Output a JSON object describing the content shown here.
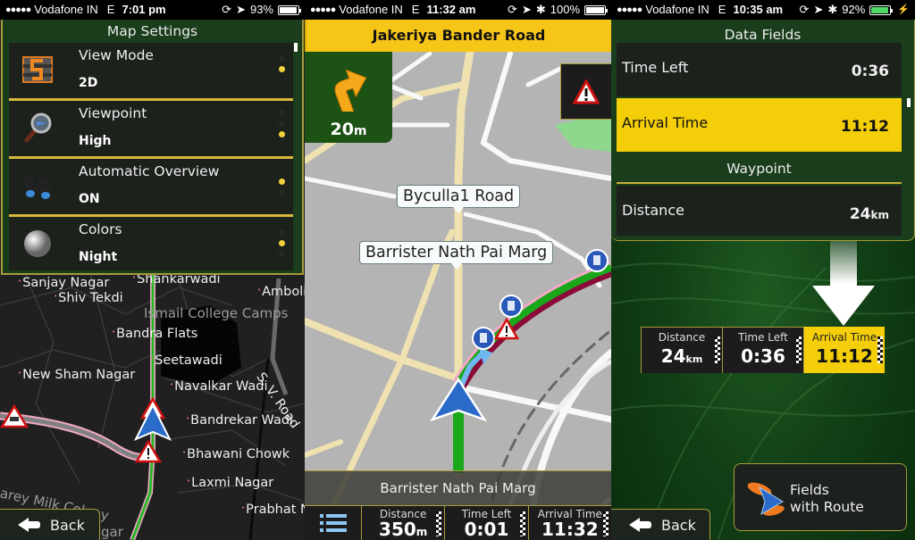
{
  "screens": [
    {
      "status": {
        "carrier": "Vodafone IN",
        "network": "E",
        "time": "7:01 pm",
        "battery": "93%"
      },
      "settings": {
        "title": "Map Settings",
        "items": [
          {
            "label": "View Mode",
            "value": "2D",
            "icon": "view-mode-icon",
            "options_count": 2,
            "selected_index": 1
          },
          {
            "label": "Viewpoint",
            "value": "High",
            "icon": "magnifier-icon",
            "options_count": 3,
            "selected_index": 2
          },
          {
            "label": "Automatic Overview",
            "value": "ON",
            "icon": "binoculars-icon",
            "options_count": 2,
            "selected_index": 0
          },
          {
            "label": "Colors",
            "value": "Night",
            "icon": "moon-icon",
            "options_count": 3,
            "selected_index": 1
          }
        ]
      },
      "map_places": [
        "Sanjay Nagar",
        "Shankarwadi",
        "Amboli",
        "Shiv Tekdi",
        "Ismail College Camps",
        "Bandra Flats",
        "Seetawadi",
        "New Sham Nagar",
        "Navalkar Wadi",
        "S. V. Road",
        "Bandrekar Wadi",
        "Bhawani Chowk",
        "arey Milk Colony",
        "Laxmi Nagar",
        "Prabhat N",
        "gar"
      ],
      "back_label": "Back"
    },
    {
      "status": {
        "carrier": "Vodafone IN",
        "network": "E",
        "time": "11:32 am",
        "battery": "100%"
      },
      "current_street": "Jakeriya Bander Road",
      "next_turn": {
        "distance": "20",
        "unit": "m",
        "direction": "slight-right"
      },
      "callouts": [
        "Byculla1 Road",
        "Barrister Nath Pai Marg"
      ],
      "next_street": "Barrister Nath Pai Marg",
      "data_fields": [
        {
          "label": "Distance",
          "value": "350",
          "unit": "m"
        },
        {
          "label": "Time Left",
          "value": "0:01",
          "unit": ""
        },
        {
          "label": "Arrival Time",
          "value": "11:32",
          "unit": ""
        }
      ]
    },
    {
      "status": {
        "carrier": "Vodafone IN",
        "network": "E",
        "time": "10:35 am",
        "battery": "92%",
        "charging": true
      },
      "title": "Data Fields",
      "rows": [
        {
          "label": "Time Left",
          "value": "0:36",
          "unit": "",
          "selected": false
        },
        {
          "label": "Arrival Time",
          "value": "11:12",
          "unit": "",
          "selected": true
        }
      ],
      "section": "Waypoint",
      "waypoint_rows": [
        {
          "label": "Distance",
          "value": "24",
          "unit": "km"
        }
      ],
      "preview": [
        {
          "label": "Distance",
          "value": "24",
          "unit": "km",
          "selected": false
        },
        {
          "label": "Time Left",
          "value": "0:36",
          "unit": "",
          "selected": false
        },
        {
          "label": "Arrival Time",
          "value": "11:12",
          "unit": "",
          "selected": true
        }
      ],
      "route_button": {
        "line1": "Fields",
        "line2": "with Route"
      },
      "back_label": "Back"
    }
  ],
  "colors": {
    "accent_yellow": "#f5ce0a",
    "panel_green": "#1a3d1c",
    "border_gold": "#a89c3a",
    "route_green": "#1aa81a",
    "route_magenta": "#8a0a3a"
  }
}
